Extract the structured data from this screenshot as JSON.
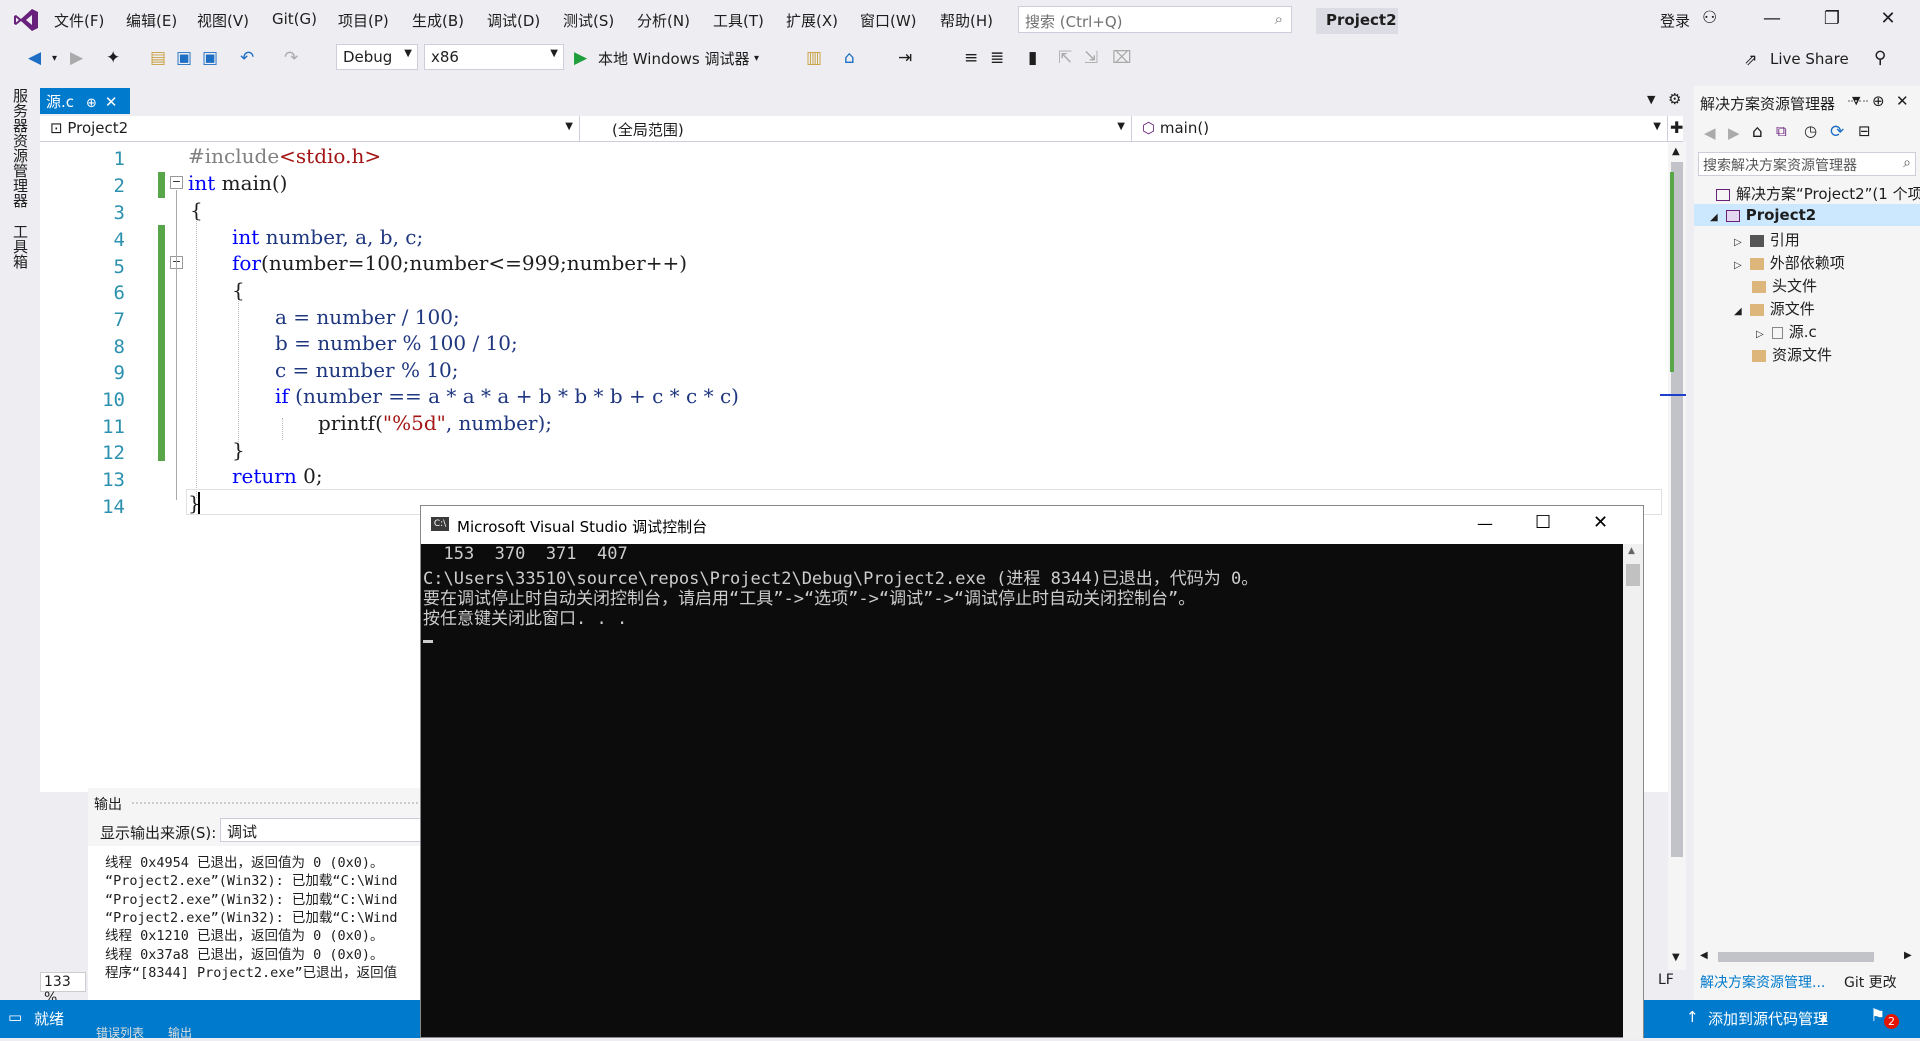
{
  "menu": [
    "文件(F)",
    "编辑(E)",
    "视图(V)",
    "Git(G)",
    "项目(P)",
    "生成(B)",
    "调试(D)",
    "测试(S)",
    "分析(N)",
    "工具(T)",
    "扩展(X)",
    "窗口(W)",
    "帮助(H)"
  ],
  "search": {
    "placeholder": "搜索 (Ctrl+Q)"
  },
  "project_name": "Project2",
  "login": "登录",
  "toolbar": {
    "config": "Debug",
    "platform": "x86",
    "run_label": "本地 Windows 调试器",
    "live_share": "Live Share"
  },
  "left_tabs": [
    "服务器资源管理器",
    "工具箱"
  ],
  "doc_tab": {
    "label": "源.c",
    "pin": "⊕"
  },
  "nav": {
    "project": "Project2",
    "scope": "(全局范围)",
    "member": "main()"
  },
  "code": {
    "line_numbers": [
      "1",
      "2",
      "3",
      "4",
      "5",
      "6",
      "7",
      "8",
      "9",
      "10",
      "11",
      "12",
      "13",
      "14"
    ],
    "l1a": "#include",
    "l1b": "<stdio.h>",
    "l2a": "int",
    "l2b": " main()",
    "l3": "{",
    "l4a": "int",
    "l4b": " number, a, b, c;",
    "l5a": "for",
    "l5b": "(number=100;number<=999;number++)",
    "l6": "{",
    "l7": "a = number / 100;",
    "l8": "b = number % 100 / 10;",
    "l9": "c = number % 10;",
    "l10a": "if",
    "l10b": " (number == a * a * a + b * b * b + c * c * c)",
    "l11a": "printf(",
    "l11b": "\"%5d\"",
    "l11c": ", number);",
    "l12": "}",
    "l13a": "return",
    "l13b": " 0;",
    "l14": "}"
  },
  "output": {
    "title": "输出",
    "source_label": "显示输出来源(S):",
    "source_value": "调试",
    "lines": [
      "线程 0x4954 已退出，返回值为 0 (0x0)。",
      "“Project2.exe”(Win32): 已加载“C:\\Wind",
      "“Project2.exe”(Win32): 已加载“C:\\Wind",
      "“Project2.exe”(Win32): 已加载“C:\\Wind",
      "线程 0x1210 已退出，返回值为 0 (0x0)。",
      "线程 0x37a8 已退出，返回值为 0 (0x0)。",
      "程序“[8344] Project2.exe”已退出，返回值"
    ]
  },
  "zoom": "133 %",
  "status": {
    "ready": "就绪",
    "source_control": "添加到源代码管理",
    "notif": "2",
    "lf": "LF",
    "bottom_tabs": [
      "错误列表",
      "输出"
    ]
  },
  "console": {
    "title": "Microsoft Visual Studio 调试控制台",
    "lines": [
      "  153  370  371  407",
      "C:\\Users\\33510\\source\\repos\\Project2\\Debug\\Project2.exe (进程 8344)已退出，代码为 0。",
      "要在调试停止时自动关闭控制台，请启用“工具”->“选项”->“调试”->“调试停止时自动关闭控制台”。",
      "按任意键关闭此窗口. . ."
    ]
  },
  "solution": {
    "title": "解决方案资源管理器",
    "search": "搜索解决方案资源管理器",
    "root": "解决方案“Project2”(1 个项",
    "project": "Project2",
    "items": [
      "引用",
      "外部依赖项",
      "头文件",
      "源文件",
      "源.c",
      "资源文件"
    ],
    "bottom_tabs": [
      "解决方案资源管理...",
      "Git 更改"
    ]
  },
  "colors": {
    "accent": "#007acc",
    "vs_purple": "#68217a",
    "keyword": "#0000ff",
    "string": "#a31515",
    "linenum": "#2b91af"
  }
}
